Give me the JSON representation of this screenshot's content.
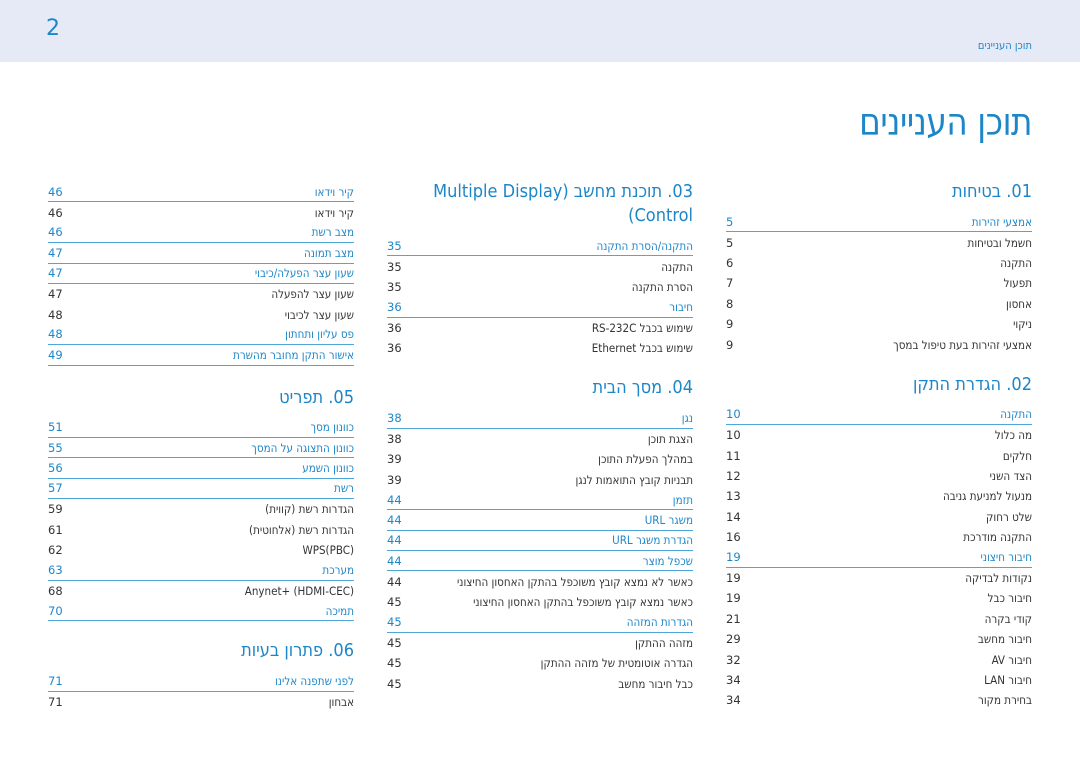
{
  "header": {
    "page_number": "2",
    "breadcrumb": "תוכן העניינים"
  },
  "page_title": "תוכן העניינים",
  "colors": {
    "accent": "#1d86c8",
    "header_bg": "#e6e9f6",
    "text": "#333333"
  },
  "columns": [
    {
      "sections": [
        {
          "title": "01. בטיחות",
          "rows": [
            {
              "label": "אמצעי זהירות",
              "page": "5",
              "type": "head"
            },
            {
              "label": "חשמל ובטיחות",
              "page": "5",
              "type": "sub"
            },
            {
              "label": "התקנה",
              "page": "6",
              "type": "sub"
            },
            {
              "label": "תפעול",
              "page": "7",
              "type": "sub"
            },
            {
              "label": "אחסון",
              "page": "8",
              "type": "sub"
            },
            {
              "label": "ניקוי",
              "page": "9",
              "type": "sub"
            },
            {
              "label": "אמצעי זהירות בעת טיפול במסך",
              "page": "9",
              "type": "sub"
            }
          ]
        },
        {
          "title": "02. הגדרת התקן",
          "rows": [
            {
              "label": "התקנה",
              "page": "10",
              "type": "head"
            },
            {
              "label": "מה כלול",
              "page": "10",
              "type": "sub"
            },
            {
              "label": "חלקים",
              "page": "11",
              "type": "sub"
            },
            {
              "label": "הצד השני",
              "page": "12",
              "type": "sub"
            },
            {
              "label": "מנעול למניעת גניבה",
              "page": "13",
              "type": "sub"
            },
            {
              "label": "שלט רחוק",
              "page": "14",
              "type": "sub"
            },
            {
              "label": "התקנה מודרכת",
              "page": "16",
              "type": "sub"
            },
            {
              "label": "חיבור חיצוני",
              "page": "19",
              "type": "head"
            },
            {
              "label": "נקודות לבדיקה",
              "page": "19",
              "type": "sub"
            },
            {
              "label": "חיבור כבל",
              "page": "19",
              "type": "sub"
            },
            {
              "label": "קודי בקרה",
              "page": "21",
              "type": "sub"
            },
            {
              "label": "חיבור מחשב",
              "page": "29",
              "type": "sub"
            },
            {
              "label": "חיבור AV",
              "page": "32",
              "type": "sub"
            },
            {
              "label": "חיבור LAN",
              "page": "34",
              "type": "sub"
            },
            {
              "label": "בחירת מקור",
              "page": "34",
              "type": "sub"
            }
          ]
        }
      ]
    },
    {
      "sections": [
        {
          "title": "03. תוכנת מחשב (Multiple Display Control)",
          "title_line1": "03. תוכנת מחשב (Multiple Display",
          "title_line2": "Control)",
          "rows": [
            {
              "label": "התקנה/הסרת התקנה",
              "page": "35",
              "type": "head"
            },
            {
              "label": "התקנה",
              "page": "35",
              "type": "sub"
            },
            {
              "label": "הסרת התקנה",
              "page": "35",
              "type": "sub"
            },
            {
              "label": "חיבור",
              "page": "36",
              "type": "head"
            },
            {
              "label": "שימוש בכבל RS-232C",
              "page": "36",
              "type": "sub"
            },
            {
              "label": "שימוש בכבל Ethernet",
              "page": "36",
              "type": "sub"
            }
          ]
        },
        {
          "title": "04. מסך הבית",
          "rows": [
            {
              "label": "נגן",
              "page": "38",
              "type": "head"
            },
            {
              "label": "הצגת תוכן",
              "page": "38",
              "type": "sub"
            },
            {
              "label": "במהלך הפעלת התוכן",
              "page": "39",
              "type": "sub"
            },
            {
              "label": "תבניות קובץ התואמות לנגן",
              "page": "39",
              "type": "sub"
            },
            {
              "label": "תזמן",
              "page": "44",
              "type": "head"
            },
            {
              "label": "משגר URL",
              "page": "44",
              "type": "head"
            },
            {
              "label": "הגדרת משגר URL",
              "page": "44",
              "type": "head"
            },
            {
              "label": "שכפל מוצר",
              "page": "44",
              "type": "head"
            },
            {
              "label": "כאשר לא נמצא קובץ משוכפל בהתקן האחסון החיצוני",
              "page": "44",
              "type": "sub"
            },
            {
              "label": "כאשר נמצא קובץ משוכפל בהתקן האחסון החיצוני",
              "page": "45",
              "type": "sub"
            },
            {
              "label": "הגדרות המזהה",
              "page": "45",
              "type": "head"
            },
            {
              "label": "מזהה ההתקן",
              "page": "45",
              "type": "sub"
            },
            {
              "label": "הגדרה אוטומטית של מזהה ההתקן",
              "page": "45",
              "type": "sub"
            },
            {
              "label": "כבל חיבור מחשב",
              "page": "45",
              "type": "sub"
            }
          ]
        }
      ]
    },
    {
      "sections": [
        {
          "title": "",
          "rows": [
            {
              "label": "קיר וידאו",
              "page": "46",
              "type": "head"
            },
            {
              "label": "קיר וידאו",
              "page": "46",
              "type": "sub"
            },
            {
              "label": "מצב רשת",
              "page": "46",
              "type": "head"
            },
            {
              "label": "מצב תמונה",
              "page": "47",
              "type": "head"
            },
            {
              "label": "שעון עצר הפעלה/כיבוי",
              "page": "47",
              "type": "head"
            },
            {
              "label": "שעון עצר להפעלה",
              "page": "47",
              "type": "sub"
            },
            {
              "label": "שעון עצר לכיבוי",
              "page": "48",
              "type": "sub"
            },
            {
              "label": "פס עליון ותחתון",
              "page": "48",
              "type": "head"
            },
            {
              "label": "אישור התקן מחובר מהשרת",
              "page": "49",
              "type": "head"
            }
          ]
        },
        {
          "title": "05. תפריט",
          "rows": [
            {
              "label": "כוונון מסך",
              "page": "51",
              "type": "head"
            },
            {
              "label": "כוונון התצוגה על המסך",
              "page": "55",
              "type": "head"
            },
            {
              "label": "כוונון השמע",
              "page": "56",
              "type": "head"
            },
            {
              "label": "רשת",
              "page": "57",
              "type": "head"
            },
            {
              "label": "הגדרות רשת (קווית)",
              "page": "59",
              "type": "sub"
            },
            {
              "label": "הגדרות רשת (אלחוטית)",
              "page": "61",
              "type": "sub"
            },
            {
              "label": "WPS(PBC)",
              "page": "62",
              "type": "sub"
            },
            {
              "label": "מערכת",
              "page": "63",
              "type": "head"
            },
            {
              "label": "Anynet+ (HDMI-CEC)",
              "page": "68",
              "type": "sub"
            },
            {
              "label": "תמיכה",
              "page": "70",
              "type": "head"
            }
          ]
        },
        {
          "title": "06. פתרון בעיות",
          "rows": [
            {
              "label": "לפני שתפנה אלינו",
              "page": "71",
              "type": "head"
            },
            {
              "label": "אבחון",
              "page": "71",
              "type": "sub"
            }
          ]
        }
      ]
    }
  ]
}
